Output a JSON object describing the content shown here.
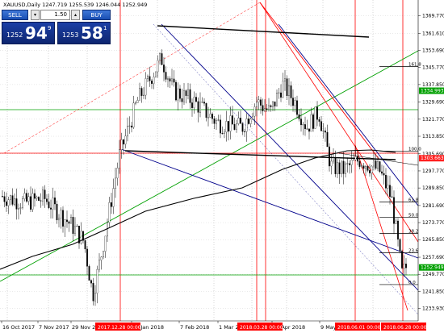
{
  "chart_title": "XAUUSD,Daily",
  "ohlc": "1247.719 1255.539 1246.044 1252.949",
  "trade_panel": {
    "sell_label": "SELL",
    "buy_label": "BUY",
    "lot_size": "1.50",
    "sell_price_prefix": "1252",
    "sell_price_big": "94",
    "sell_price_sup": "9",
    "buy_price_prefix": "1253",
    "buy_price_big": "58",
    "buy_price_sup": "1"
  },
  "price_axis": [
    "1369.770",
    "1361.610",
    "1353.690",
    "1345.770",
    "1337.850",
    "1329.690",
    "1321.770",
    "1313.850",
    "1305.690",
    "1297.770",
    "1289.850",
    "1281.690",
    "1273.770",
    "1265.850",
    "1257.690",
    "1249.770",
    "1241.850",
    "1233.930"
  ],
  "price_range": [
    1230.0,
    1373.0
  ],
  "date_axis": [
    "16 Oct 2017",
    "7 Nov 2017",
    "29 Nov 2017",
    "16 Jan 2018",
    "7 Feb 2018",
    "1 Mar 2018",
    "17 Apr 2018",
    "9 May 2018"
  ],
  "date_tags": [
    "2017.12.28 00:00",
    "2018.03.28 00:00",
    "2018.06.01 00:00",
    "2018.06.28 00:00"
  ],
  "price_tags": [
    {
      "label": "1334.993",
      "value": 1334.993,
      "color": "#00a000"
    },
    {
      "label": "1303.663",
      "value": 1303.663,
      "color": "#ff2020"
    },
    {
      "label": "1252.949",
      "value": 1252.949,
      "color": "#00a000"
    }
  ],
  "fibo_levels": [
    {
      "label": "161.8",
      "value": 1346.2
    },
    {
      "label": "100.0",
      "value": 1307.0
    },
    {
      "label": "61.8",
      "value": 1283.4
    },
    {
      "label": "50.0",
      "value": 1276.2
    },
    {
      "label": "38.2",
      "value": 1268.8
    },
    {
      "label": "23.6",
      "value": 1259.7
    },
    {
      "label": "0.0",
      "value": 1245.0
    }
  ],
  "colors": {
    "background": "#ffffff",
    "bull": "#000000",
    "bear": "#000000",
    "ma": "#000000",
    "green_line": "#00a000",
    "red_line": "#ff0000",
    "blue_line": "#00008b",
    "grid": "#c8c8c8"
  }
}
